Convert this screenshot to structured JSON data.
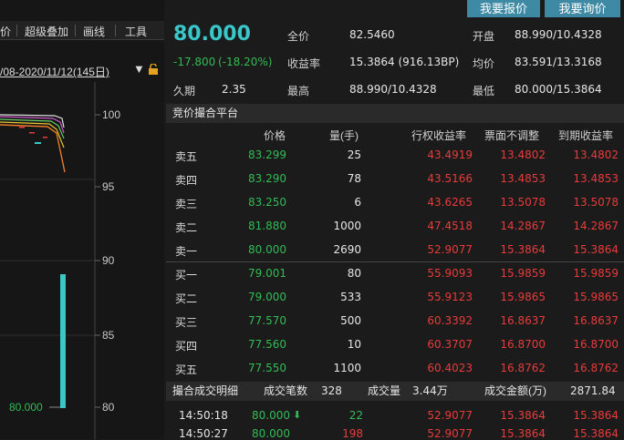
{
  "buttons": {
    "report": "我要报价",
    "inquiry": "我要询价"
  },
  "toolbar": [
    "价",
    "超级叠加",
    "画线",
    "工具"
  ],
  "date_range": "/08-2020/11/12(145日)",
  "chart": {
    "y_ticks": [
      "100",
      "95",
      "90",
      "85",
      "80"
    ],
    "last_price_label": "80.000",
    "series_colors": [
      "#e0e0e0",
      "#d05cd0",
      "#66cc66",
      "#e8c531",
      "#e87b2b"
    ],
    "volume_color": "#39c7c9"
  },
  "quote": {
    "last": "80.000",
    "change": "-17.800",
    "change_pct": "(-18.20%)",
    "tenor_label": "久期",
    "tenor": "2.35",
    "full_price_label": "全价",
    "full_price": "82.5460",
    "yield_label": "收益率",
    "yield": "15.3864 (916.13BP)",
    "high_label": "最高",
    "high": "88.990/10.4328",
    "open_label": "开盘",
    "open": "88.990/10.4328",
    "avg_label": "均价",
    "avg": "83.591/13.3168",
    "low_label": "最低",
    "low": "80.000/15.3864"
  },
  "auction": {
    "title": "竞价撮合平台",
    "headers": [
      "价格",
      "量(手)",
      "行权收益率",
      "票面不调整",
      "到期收益率"
    ],
    "asks": [
      [
        "卖五",
        "83.299",
        "25",
        "43.4919",
        "13.4802",
        "13.4802"
      ],
      [
        "卖四",
        "83.290",
        "78",
        "43.5166",
        "13.4853",
        "13.4853"
      ],
      [
        "卖三",
        "83.250",
        "6",
        "43.6265",
        "13.5078",
        "13.5078"
      ],
      [
        "卖二",
        "81.880",
        "1000",
        "47.4518",
        "14.2867",
        "14.2867"
      ],
      [
        "卖一",
        "80.000",
        "2690",
        "52.9077",
        "15.3864",
        "15.3864"
      ]
    ],
    "bids": [
      [
        "买一",
        "79.001",
        "80",
        "55.9093",
        "15.9859",
        "15.9859"
      ],
      [
        "买二",
        "79.000",
        "533",
        "55.9123",
        "15.9865",
        "15.9865"
      ],
      [
        "买三",
        "77.570",
        "500",
        "60.3392",
        "16.8637",
        "16.8637"
      ],
      [
        "买四",
        "77.560",
        "10",
        "60.3707",
        "16.8700",
        "16.8700"
      ],
      [
        "买五",
        "77.550",
        "1100",
        "60.4023",
        "16.8762",
        "16.8762"
      ]
    ]
  },
  "trades": {
    "title": "撮合成交明细",
    "count_label": "成交笔数",
    "count": "328",
    "vol_label": "成交量",
    "vol": "3.44万",
    "amount_label": "成交金额(万)",
    "amount": "2871.84",
    "rows": [
      [
        "14:50:18",
        "80.000",
        "22",
        "52.9077",
        "15.3864",
        "15.3864"
      ],
      [
        "14:50:27",
        "80.000",
        "198",
        "52.9077",
        "15.3864",
        "15.3864"
      ]
    ]
  }
}
